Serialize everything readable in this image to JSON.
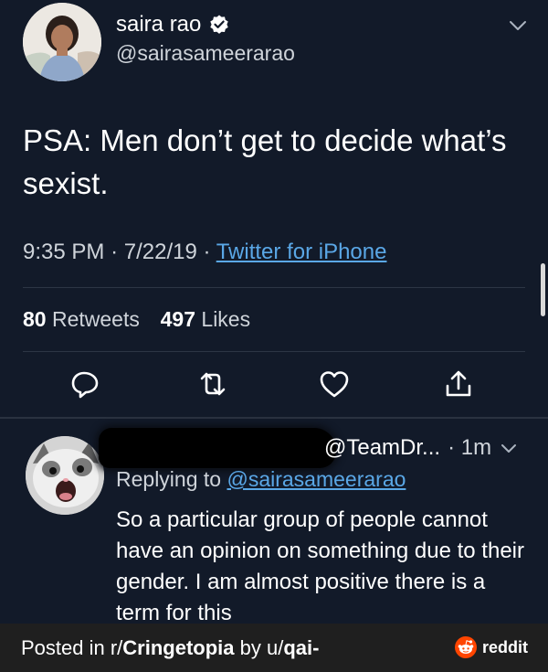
{
  "tweet": {
    "author_name": "saira rao",
    "author_handle": "@sairasameerarao",
    "text": "PSA: Men don’t get to decide what’s sexist.",
    "time": "9:35 PM",
    "date": "7/22/19",
    "source": "Twitter for iPhone",
    "retweets_count": "80",
    "retweets_label": "Retweets",
    "likes_count": "497",
    "likes_label": "Likes",
    "icons": [
      "reply-icon",
      "retweet-icon",
      "like-icon",
      "share-icon"
    ]
  },
  "reply": {
    "handle": "@TeamDr...",
    "time": "1m",
    "replying_prefix": "Replying to",
    "replying_handle": "@sairasameerarao",
    "text": "So a particular group of people cannot have an opinion on something due to their gender. I am almost positive there is a term for this"
  },
  "footer": {
    "prefix": "Posted in r/",
    "subreddit": "Cringetopia",
    "middle": " by u/",
    "user": "qai-",
    "brand": "reddit"
  },
  "colors": {
    "background": "#121a29",
    "link": "#5aa7e6",
    "muted_text": "#cfd4da",
    "footer_bg": "#1f1f1f",
    "reddit_orange": "#ff4500"
  }
}
